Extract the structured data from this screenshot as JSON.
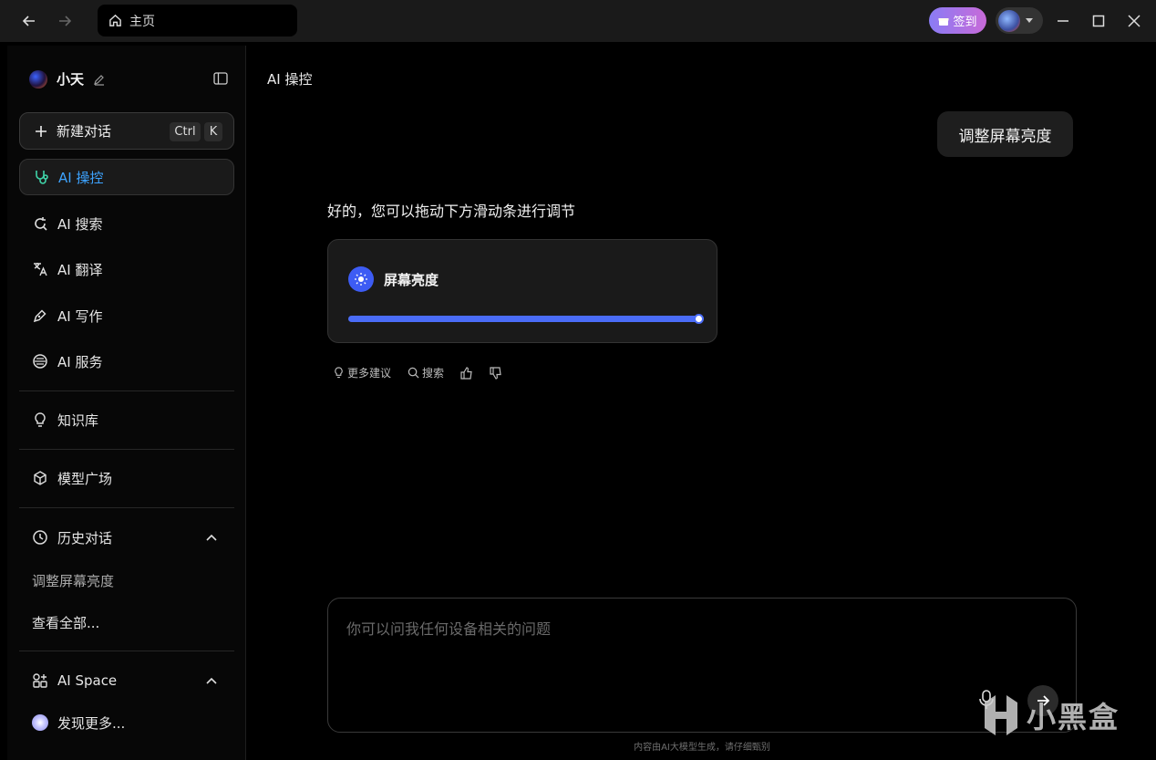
{
  "titlebar": {
    "address": "主页",
    "checkin_label": "签到"
  },
  "sidebar": {
    "username": "小天",
    "new_chat": {
      "label": "新建对话",
      "shortcut_ctrl": "Ctrl",
      "shortcut_key": "K"
    },
    "items": [
      {
        "label": "AI 操控",
        "icon": "stethoscope-icon"
      },
      {
        "label": "AI 搜索",
        "icon": "search-refresh-icon"
      },
      {
        "label": "AI 翻译",
        "icon": "translate-icon"
      },
      {
        "label": "AI 写作",
        "icon": "pen-icon"
      },
      {
        "label": "AI 服务",
        "icon": "service-icon"
      }
    ],
    "knowledge_base": "知识库",
    "model_square": "模型广场",
    "history": {
      "title": "历史对话",
      "entries": [
        "调整屏幕亮度"
      ],
      "view_all": "查看全部..."
    },
    "ai_space": {
      "title": "AI Space",
      "discover": "发现更多..."
    }
  },
  "main": {
    "title": "AI 操控",
    "user_message": "调整屏幕亮度",
    "ai_reply": "好的，您可以拖动下方滑动条进行调节",
    "brightness_card": {
      "title": "屏幕亮度",
      "level": 1.0
    },
    "actions": {
      "more_suggestions": "更多建议",
      "search": "搜索"
    },
    "input_placeholder": "你可以问我任何设备相关的问题",
    "disclaimer": "内容由AI大模型生成，请仔细甄别"
  },
  "watermark": "小黑盒",
  "colors": {
    "accent": "#4a6cf7",
    "active_nav": "#3da3ff"
  }
}
